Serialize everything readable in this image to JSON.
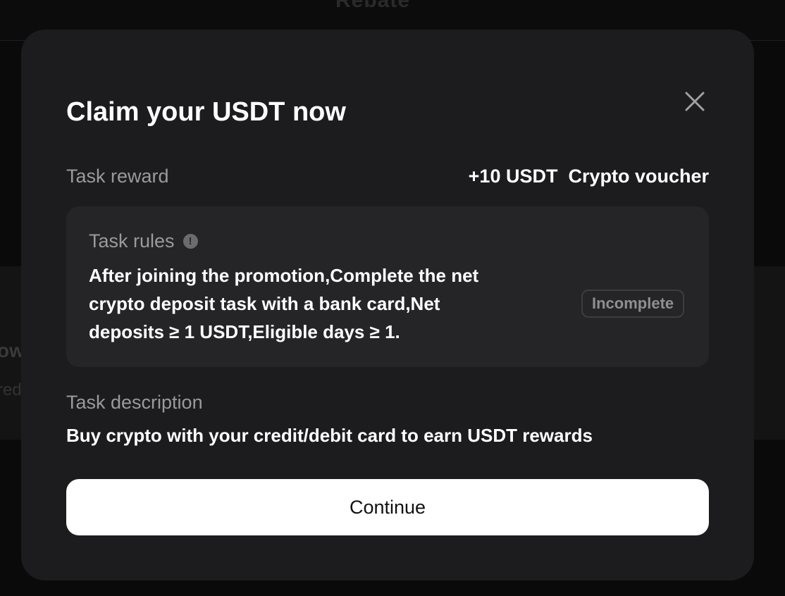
{
  "background": {
    "header_title": "Rebate",
    "peek_title": "ow",
    "peek_subtitle": "red"
  },
  "modal": {
    "title": "Claim your USDT now",
    "close_icon": "close-icon",
    "reward": {
      "label": "Task reward",
      "value": "+10 USDT  Crypto voucher"
    },
    "rules": {
      "label": "Task rules",
      "info_icon": "info-icon",
      "text": "After joining the promotion,Complete the net crypto deposit task with a bank card,Net deposits ≥ 1 USDT,Eligible days ≥ 1.",
      "status": "Incomplete"
    },
    "description": {
      "label": "Task description",
      "text": "Buy crypto with your credit/debit card to earn USDT rewards"
    },
    "continue_label": "Continue"
  },
  "colors": {
    "modal_bg": "#1c1c1e",
    "card_bg": "#252528",
    "muted_text": "#9a9a9c",
    "button_bg": "#ffffff"
  }
}
